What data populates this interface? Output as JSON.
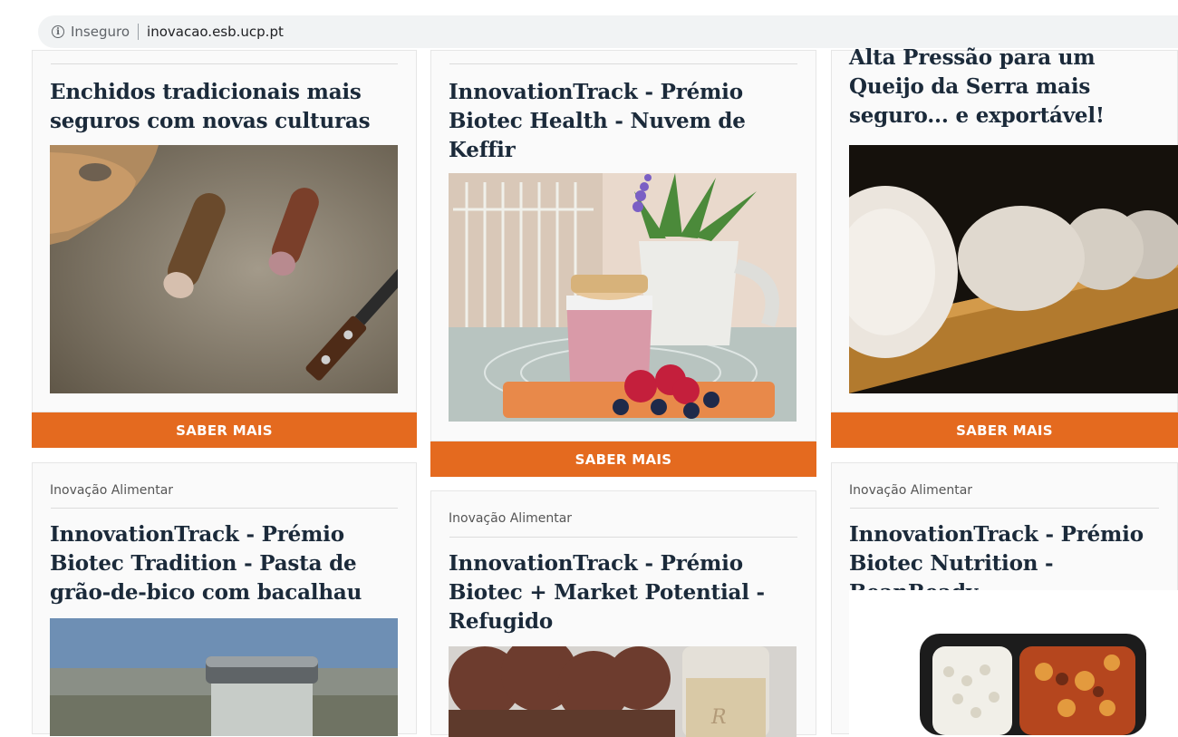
{
  "browser": {
    "security_label": "Inseguro",
    "url": "inovacao.esb.ucp.pt",
    "info_icon": "info-icon"
  },
  "cards": [
    {
      "title": "Enchidos tradicionais mais seguros com novas culturas",
      "button": "SABER MAIS"
    },
    {
      "title": "InnovationTrack - Prémio Biotec Health - Nuvem de Keffir",
      "button": "SABER MAIS"
    },
    {
      "title": "Alta Pressão para um Queijo da Serra mais seguro... e exportável!",
      "button": "SABER MAIS"
    },
    {
      "category": "Inovação Alimentar",
      "title": "InnovationTrack - Prémio Biotec Tradition - Pasta de grão-de-bico com bacalhau"
    },
    {
      "category": "Inovação Alimentar",
      "title": "InnovationTrack - Prémio Biotec + Market Potential - Refugido"
    },
    {
      "category": "Inovação Alimentar",
      "title": "InnovationTrack - Prémio Biotec Nutrition - BeanReady"
    }
  ],
  "colors": {
    "accent": "#e46a1f",
    "title": "#1b2a3a"
  }
}
